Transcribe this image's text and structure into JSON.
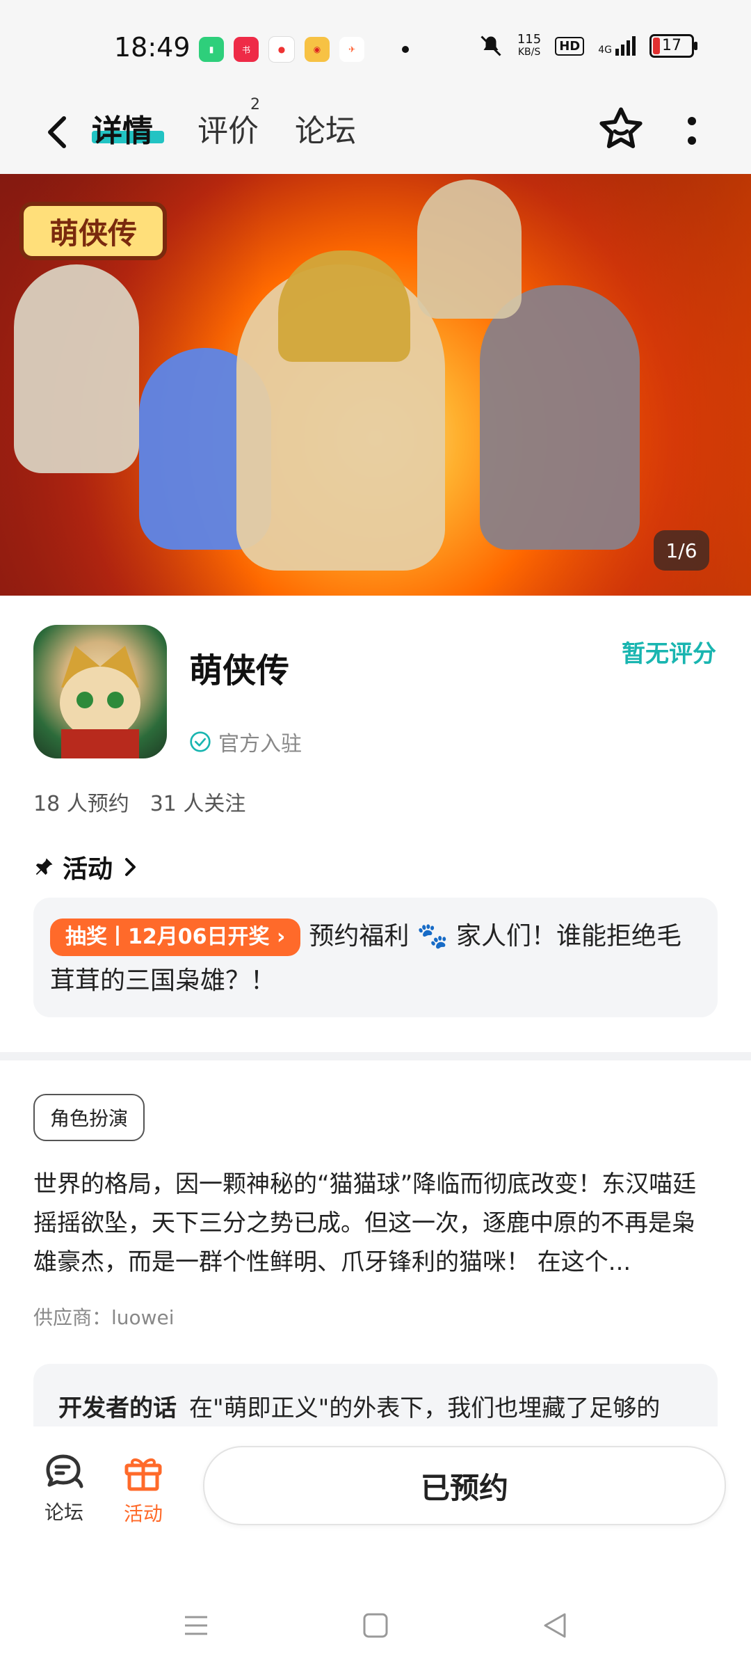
{
  "status_bar": {
    "time": "18:49",
    "net_speed_value": "115",
    "net_speed_unit": "KB/S",
    "hd": "HD",
    "signal": "4G",
    "battery": "17"
  },
  "nav": {
    "tabs": [
      {
        "label": "详情"
      },
      {
        "label": "评价",
        "badge": "2"
      },
      {
        "label": "论坛"
      }
    ]
  },
  "banner": {
    "logo_text": "萌侠传",
    "counter": "1/6"
  },
  "app": {
    "name": "萌侠传",
    "verified_label": "官方入驻",
    "rating_text": "暂无评分",
    "stats": [
      "18 人预约",
      "31 人关注"
    ]
  },
  "activity": {
    "header": "活动",
    "pill": "抽奖丨12月06日开奖",
    "text": "预约福利 🐾 家人们！谁能拒绝毛茸茸的三国枭雄？！"
  },
  "description": {
    "genre": "角色扮演",
    "text": "世界的格局，因一颗神秘的“猫猫球”降临而彻底改变！东汉喵廷摇摇欲坠，天下三分之势已成。但这一次，逐鹿中原的不再是枭雄豪杰，而是一群个性鲜明、爪牙锋利的猫咪！ 在这个...",
    "supplier": "供应商：luowei"
  },
  "developer_note": {
    "title": "开发者的话",
    "text": "在\"萌即正义\"的外表下，我们也埋藏了足够的"
  },
  "bottom_bar": {
    "forum_label": "论坛",
    "activity_label": "活动",
    "reserve_button": "已预约"
  },
  "colors": {
    "accent": "#19b5b0",
    "activity_orange": "#ff6a2a",
    "tab_underline": "#22c3c3"
  }
}
